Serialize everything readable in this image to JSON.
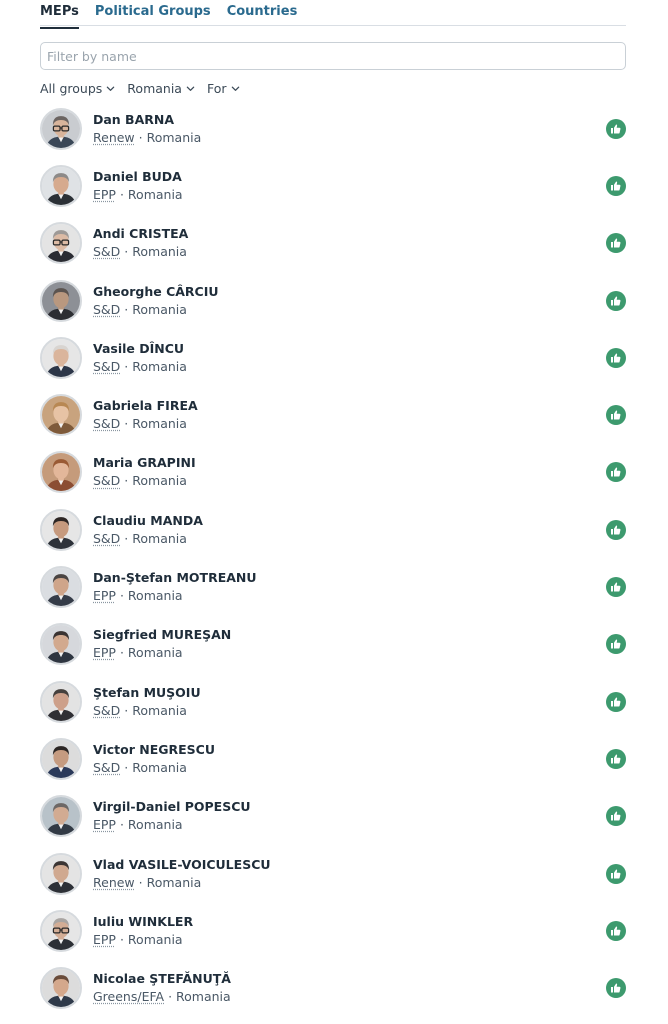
{
  "tabs": [
    {
      "label": "MEPs",
      "active": true
    },
    {
      "label": "Political Groups",
      "active": false
    },
    {
      "label": "Countries",
      "active": false
    }
  ],
  "search": {
    "placeholder": "Filter by name",
    "value": ""
  },
  "filters": {
    "group": "All groups",
    "country": "Romania",
    "position": "For"
  },
  "colors": {
    "vote_for": "#3d9a6e",
    "link": "#2a6a8e"
  },
  "vote_icon": "thumbs-up-icon",
  "meps": [
    {
      "name": "Dan BARNA",
      "group": "Renew",
      "country": "Romania",
      "vote": "for",
      "avatar": {
        "skin": "#d8b49b",
        "hair": "#6b6461",
        "suit": "#3a4757",
        "bg": "#c9ccd0",
        "glasses": true
      }
    },
    {
      "name": "Daniel BUDA",
      "group": "EPP",
      "country": "Romania",
      "vote": "for",
      "avatar": {
        "skin": "#d6aa8e",
        "hair": "#8d8a88",
        "suit": "#2b3036",
        "bg": "#dfe2e5",
        "glasses": false
      }
    },
    {
      "name": "Andi CRISTEA",
      "group": "S&D",
      "country": "Romania",
      "vote": "for",
      "avatar": {
        "skin": "#dcbba5",
        "hair": "#9e9a97",
        "suit": "#2a2c33",
        "bg": "#e4e4e4",
        "glasses": true
      }
    },
    {
      "name": "Gheorghe CÂRCIU",
      "group": "S&D",
      "country": "Romania",
      "vote": "for",
      "avatar": {
        "skin": "#b9987f",
        "hair": "#5b5450",
        "suit": "#2c2e33",
        "bg": "#8d9096",
        "glasses": false
      }
    },
    {
      "name": "Vasile DÎNCU",
      "group": "S&D",
      "country": "Romania",
      "vote": "for",
      "avatar": {
        "skin": "#dab59c",
        "hair": "#d8d4d0",
        "suit": "#2c3648",
        "bg": "#e6e6e6",
        "glasses": false
      }
    },
    {
      "name": "Gabriela FIREA",
      "group": "S&D",
      "country": "Romania",
      "vote": "for",
      "avatar": {
        "skin": "#e7c3a5",
        "hair": "#b88853",
        "suit": "#7e5a3a",
        "bg": "#c8a37e",
        "glasses": false
      }
    },
    {
      "name": "Maria GRAPINI",
      "group": "S&D",
      "country": "Romania",
      "vote": "for",
      "avatar": {
        "skin": "#e3b79a",
        "hair": "#9a5a34",
        "suit": "#8b4d33",
        "bg": "#c59b7b",
        "glasses": false
      }
    },
    {
      "name": "Claudiu MANDA",
      "group": "S&D",
      "country": "Romania",
      "vote": "for",
      "avatar": {
        "skin": "#c69a7e",
        "hair": "#2d2624",
        "suit": "#2d323a",
        "bg": "#e6e6e6",
        "glasses": false
      }
    },
    {
      "name": "Dan-Ştefan MOTREANU",
      "group": "EPP",
      "country": "Romania",
      "vote": "for",
      "avatar": {
        "skin": "#cfa58a",
        "hair": "#4a4442",
        "suit": "#353c48",
        "bg": "#dadde1",
        "glasses": false
      }
    },
    {
      "name": "Siegfried MUREŞAN",
      "group": "EPP",
      "country": "Romania",
      "vote": "for",
      "avatar": {
        "skin": "#d2a98e",
        "hair": "#3a3331",
        "suit": "#2e3540",
        "bg": "#d6d8dc",
        "glasses": false
      }
    },
    {
      "name": "Ştefan MUŞOIU",
      "group": "S&D",
      "country": "Romania",
      "vote": "for",
      "avatar": {
        "skin": "#cda08a",
        "hair": "#45403d",
        "suit": "#2f2f34",
        "bg": "#e3e3e3",
        "glasses": false
      }
    },
    {
      "name": "Victor NEGRESCU",
      "group": "S&D",
      "country": "Romania",
      "vote": "for",
      "avatar": {
        "skin": "#c59b80",
        "hair": "#2c2624",
        "suit": "#2b3a5a",
        "bg": "#dcdcdc",
        "glasses": false
      }
    },
    {
      "name": "Virgil-Daniel POPESCU",
      "group": "EPP",
      "country": "Romania",
      "vote": "for",
      "avatar": {
        "skin": "#d2ab92",
        "hair": "#6d6866",
        "suit": "#323a45",
        "bg": "#b8c2c9",
        "glasses": false
      }
    },
    {
      "name": "Vlad VASILE-VOICULESCU",
      "group": "Renew",
      "country": "Romania",
      "vote": "for",
      "avatar": {
        "skin": "#d0a990",
        "hair": "#3b3533",
        "suit": "#2d3037",
        "bg": "#e4e4e4",
        "glasses": false
      }
    },
    {
      "name": "Iuliu WINKLER",
      "group": "EPP",
      "country": "Romania",
      "vote": "for",
      "avatar": {
        "skin": "#d3ad95",
        "hair": "#a9a5a2",
        "suit": "#2c3036",
        "bg": "#e6e6e6",
        "glasses": true
      }
    },
    {
      "name": "Nicolae ŞTEFĂNUŢĂ",
      "group": "Greens/EFA",
      "country": "Romania",
      "vote": "for",
      "avatar": {
        "skin": "#d4a88c",
        "hair": "#6a4c3a",
        "suit": "#2f3a4a",
        "bg": "#dcdcdc",
        "glasses": false
      }
    }
  ]
}
